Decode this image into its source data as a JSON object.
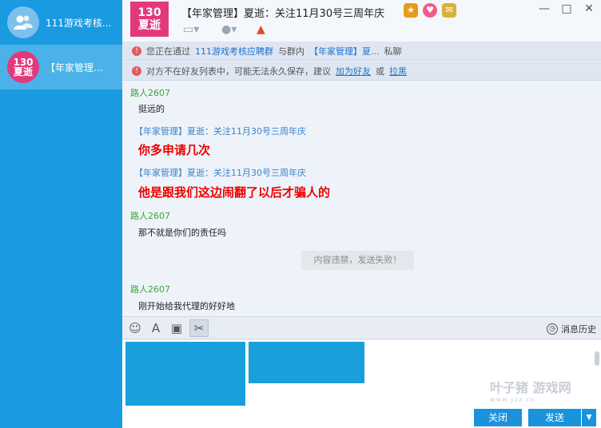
{
  "sidebar": {
    "items": [
      {
        "label": "111游戏考核..."
      },
      {
        "label": "【年家管理...",
        "avatar_top": "130",
        "avatar_bottom": "夏逝"
      }
    ]
  },
  "header": {
    "avatar_top": "130",
    "avatar_bottom": "夏逝",
    "title": "【年家管理】夏逝：关注11月30号三周年庆"
  },
  "notices": {
    "first": {
      "prefix": "您正在通过",
      "group": "111游戏考核应聘群",
      "middle": "与群内",
      "member": "【年家管理】夏...",
      "suffix": "私聊"
    },
    "second": {
      "prefix": "对方不在好友列表中，可能无法永久保存，建议",
      "add_friend": "加为好友",
      "or": "或",
      "block": "拉黑"
    }
  },
  "messages": [
    {
      "sender": "路人2607",
      "text": "挺远的"
    },
    {
      "sender": "【年家管理】夏逝：关注11月30号三周年庆",
      "text": "你多申请几次"
    },
    {
      "sender": "【年家管理】夏逝：关注11月30号三周年庆",
      "text": "他是跟我们这边闹翻了以后才骗人的"
    },
    {
      "sender": "路人2607",
      "text": "那不就是你们的责任吗"
    },
    {
      "sender": "路人2607",
      "text": "刚开始给我代理的好好地"
    }
  ],
  "system_message": "内容违禁，发送失败！",
  "input_toolbar": {
    "history_label": "消息历史"
  },
  "watermark": {
    "title": "叶子猪 游戏网",
    "url": "www.yzz.cn"
  },
  "buttons": {
    "close": "关闭",
    "send": "发送",
    "send_menu": "▼"
  },
  "colors": {
    "sidebar": "#1a9ae0",
    "accent_blue": "#1a92dc",
    "sender_green": "#3aa53a",
    "sender_blue": "#3a82c8",
    "alert_red": "#e00000"
  }
}
